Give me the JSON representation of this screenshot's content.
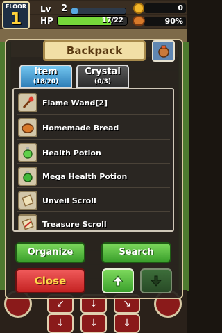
{
  "hud": {
    "floor_label": "FLOOR",
    "floor_number": "1",
    "level_label": "Lv",
    "level_value": "2",
    "xp_fraction": 0.12,
    "hp_label": "HP",
    "hp_text": "17/22",
    "hp_fraction": 0.77,
    "gold": "0",
    "satiety": "90%"
  },
  "panel": {
    "title": "Backpack",
    "tabs": [
      {
        "label": "Item",
        "count": "(18/20)"
      },
      {
        "label": "Crystal",
        "count": "(0/3)"
      }
    ],
    "items": [
      {
        "label": "Flame Wand[2]",
        "icon": "wand-icon"
      },
      {
        "label": "Homemade Bread",
        "icon": "bread-icon"
      },
      {
        "label": "Health Potion",
        "icon": "potion-icon"
      },
      {
        "label": "Mega Health Potion",
        "icon": "potion-icon"
      },
      {
        "label": "Unveil Scroll",
        "icon": "scroll-icon"
      },
      {
        "label": "Treasure Scroll",
        "icon": "scroll-icon"
      }
    ],
    "buttons": {
      "organize": "Organize",
      "search": "Search",
      "close": "Close"
    }
  },
  "colors": {
    "accent_green": "#3ba02c",
    "accent_red": "#c42222",
    "tab_active": "#2f7fb8"
  }
}
